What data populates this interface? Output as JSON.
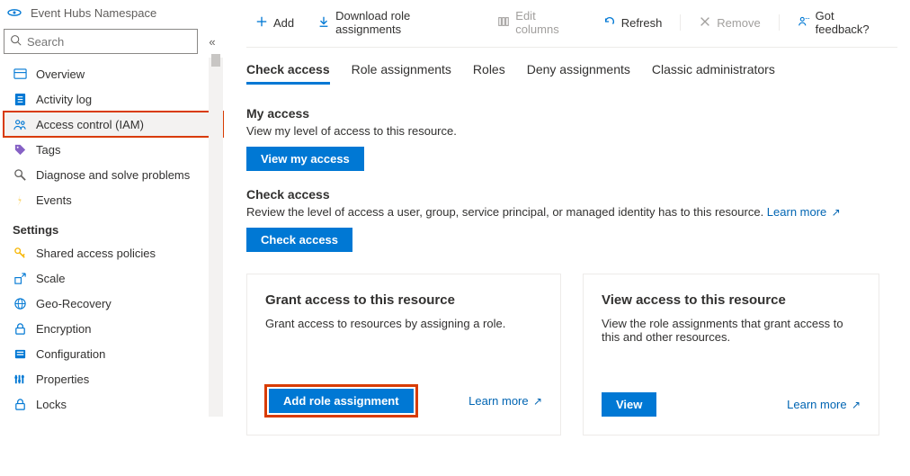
{
  "resource": {
    "type_label": "Event Hubs Namespace"
  },
  "search": {
    "placeholder": "Search"
  },
  "nav": {
    "items": [
      {
        "label": "Overview"
      },
      {
        "label": "Activity log"
      },
      {
        "label": "Access control (IAM)"
      },
      {
        "label": "Tags"
      },
      {
        "label": "Diagnose and solve problems"
      },
      {
        "label": "Events"
      }
    ],
    "settings_header": "Settings",
    "settings": [
      {
        "label": "Shared access policies"
      },
      {
        "label": "Scale"
      },
      {
        "label": "Geo-Recovery"
      },
      {
        "label": "Encryption"
      },
      {
        "label": "Configuration"
      },
      {
        "label": "Properties"
      },
      {
        "label": "Locks"
      }
    ]
  },
  "toolbar": {
    "add": "Add",
    "download": "Download role assignments",
    "edit_columns": "Edit columns",
    "refresh": "Refresh",
    "remove": "Remove",
    "feedback": "Got feedback?"
  },
  "tabs": {
    "check_access": "Check access",
    "role_assignments": "Role assignments",
    "roles": "Roles",
    "deny_assignments": "Deny assignments",
    "classic": "Classic administrators"
  },
  "my_access": {
    "title": "My access",
    "desc": "View my level of access to this resource.",
    "button": "View my access"
  },
  "check_access": {
    "title": "Check access",
    "desc": "Review the level of access a user, group, service principal, or managed identity has to this resource. ",
    "learn_more": "Learn more",
    "button": "Check access"
  },
  "card_grant": {
    "title": "Grant access to this resource",
    "desc": "Grant access to resources by assigning a role.",
    "button": "Add role assignment",
    "learn_more": "Learn more"
  },
  "card_view": {
    "title": "View access to this resource",
    "desc": "View the role assignments that grant access to this and other resources.",
    "button": "View",
    "learn_more": "Learn more"
  }
}
